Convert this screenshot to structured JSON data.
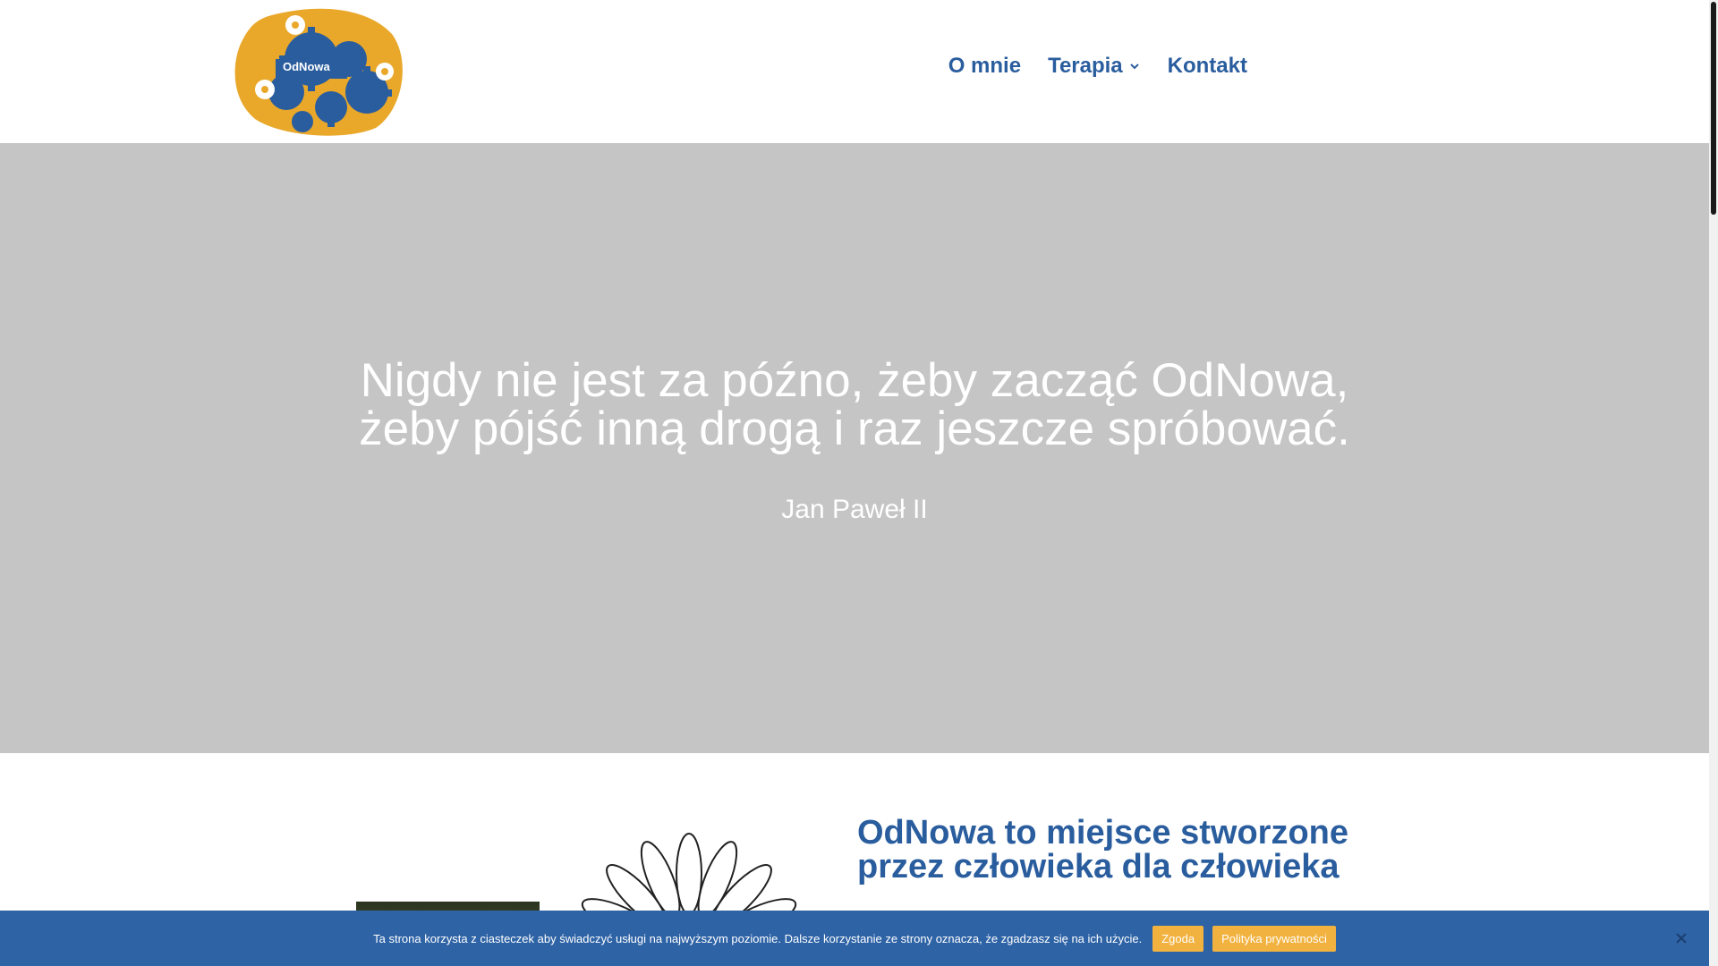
{
  "header": {
    "logo_alt": "OdNowa",
    "nav": [
      {
        "label": "O mnie"
      },
      {
        "label": "Terapia"
      },
      {
        "label": "Kontakt"
      }
    ]
  },
  "hero": {
    "quote_line1": "Nigdy nie jest za późno, żeby zacząć OdNowa,",
    "quote_line2": "żeby pójść inną drogą i raz jeszcze spróbować.",
    "author": "Jan Paweł II",
    "background_color": "#c5c5c5"
  },
  "intro": {
    "heading_line1": "OdNowa to miejsce stworzone",
    "heading_line2": "przez człowieka dla człowieka"
  },
  "cookie": {
    "text": "Ta strona korzysta z ciasteczek aby świadczyć usługi na najwyższym poziomie. Dalsze korzystanie ze strony oznacza, że zgadzasz się na ich użycie.",
    "accept_label": "Zgoda",
    "policy_label": "Polityka prywatności"
  },
  "colors": {
    "brand_blue": "#2a5d9e",
    "accent_orange": "#f2b23f",
    "cookie_bar": "#2e63a6"
  }
}
